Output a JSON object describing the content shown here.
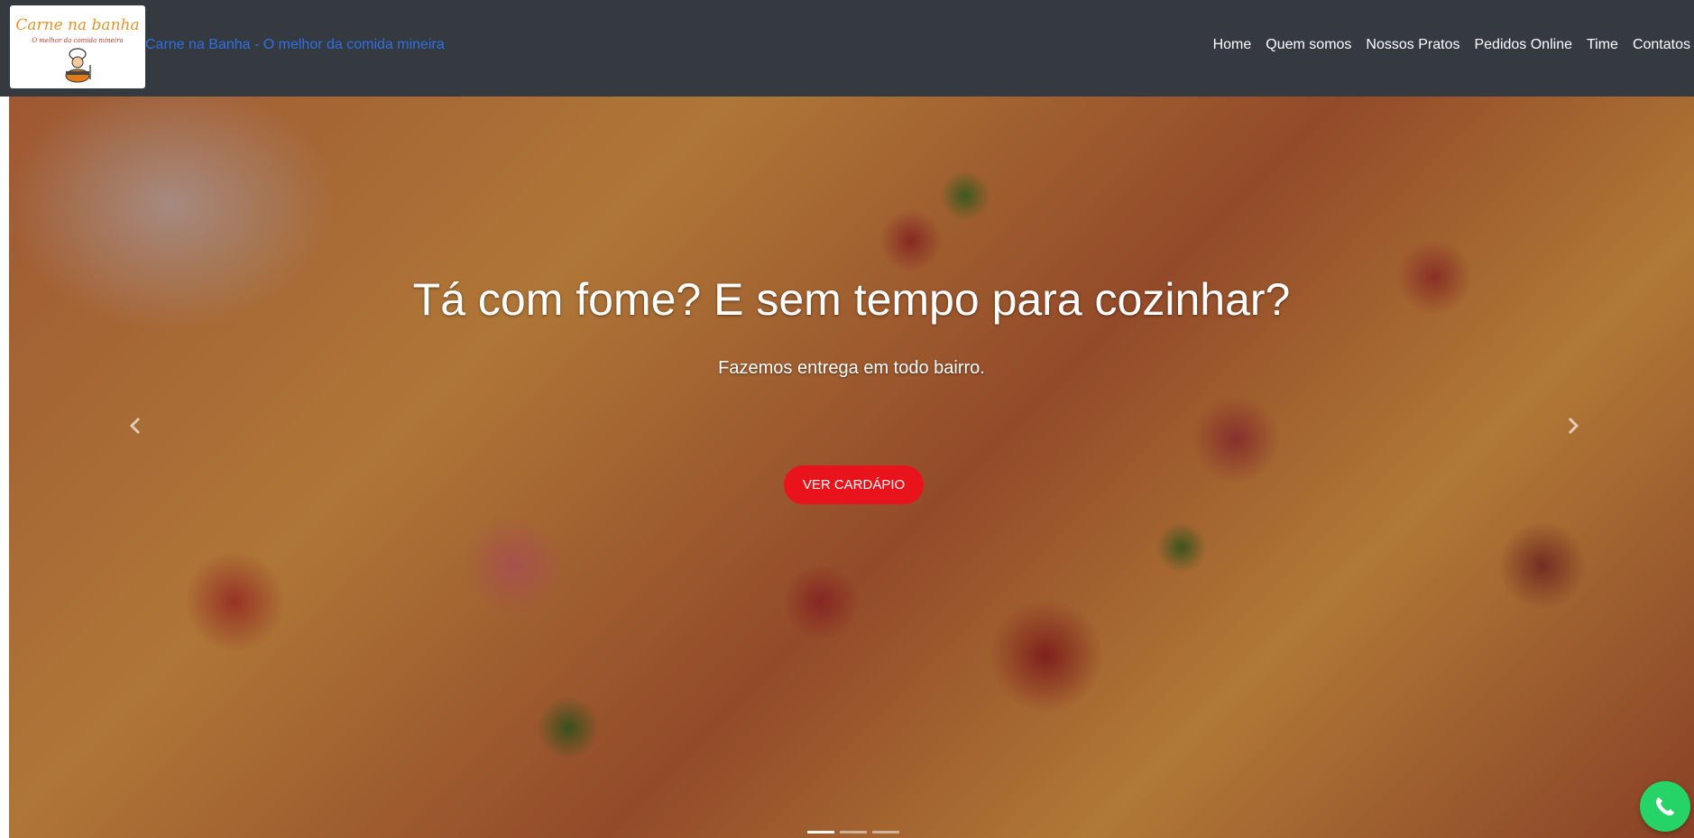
{
  "logo": {
    "title": "Carne na banha",
    "subtitle": "O melhor da comida mineira"
  },
  "brand": {
    "text": "Carne na Banha - O melhor da comida mineira"
  },
  "nav": {
    "items": [
      {
        "label": "Home"
      },
      {
        "label": "Quem somos"
      },
      {
        "label": "Nossos Pratos"
      },
      {
        "label": "Pedidos Online"
      },
      {
        "label": "Time"
      },
      {
        "label": "Contatos"
      }
    ]
  },
  "hero": {
    "heading": "Tá com fome? E sem tempo para cozinhar?",
    "subheading": "Fazemos entrega em todo bairro.",
    "cta_label": "VER CARDÁPIO",
    "prev_icon": "chevron-left-icon",
    "next_icon": "chevron-right-icon",
    "active_slide": 1,
    "slide_count": 3
  },
  "floating": {
    "icon": "whatsapp-icon",
    "color": "#25d366"
  },
  "colors": {
    "navbar": "#343a40",
    "brand_link": "#2f6fe0",
    "cta": "#e8131b"
  }
}
